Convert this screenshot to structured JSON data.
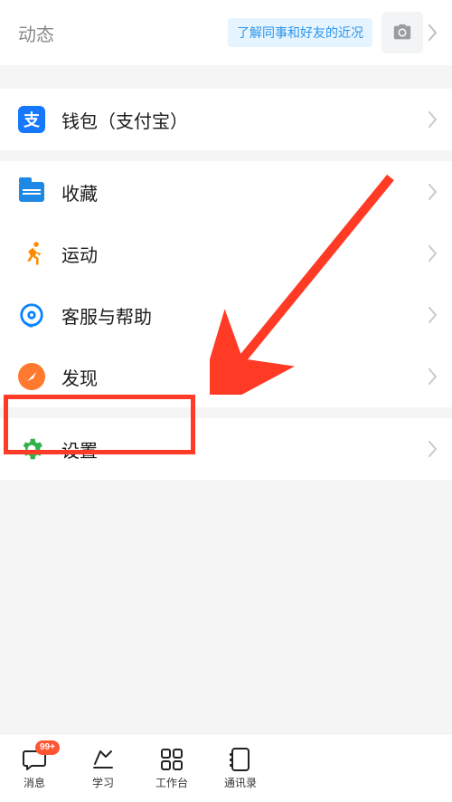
{
  "header": {
    "title": "动态",
    "hint": "了解同事和好友的近况"
  },
  "sections": {
    "wallet": "钱包（支付宝）",
    "favorites": "收藏",
    "sport": "运动",
    "help": "客服与帮助",
    "discover": "发现",
    "settings": "设置"
  },
  "tabs": {
    "messages": {
      "label": "消息",
      "badge": "99+"
    },
    "study": {
      "label": "学习"
    },
    "workspace": {
      "label": "工作台"
    },
    "contacts": {
      "label": "通讯录"
    }
  }
}
